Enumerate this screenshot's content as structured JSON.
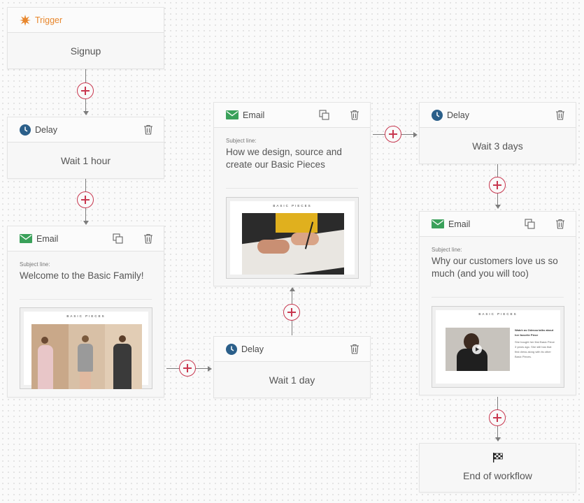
{
  "colors": {
    "accent": "#c8374f",
    "trigger": "#e8872d",
    "delay_icon": "#2b5f8a",
    "email_icon": "#3aa15a"
  },
  "trigger": {
    "label": "Trigger",
    "body": "Signup",
    "icon": "sunburst-icon"
  },
  "delay1": {
    "label": "Delay",
    "body": "Wait 1 hour",
    "icon": "clock-icon"
  },
  "email1": {
    "label": "Email",
    "subject_label": "Subject line:",
    "subject": "Welcome to the Basic Family!",
    "preview_brand": "BASIC PIECES"
  },
  "email2": {
    "label": "Email",
    "subject_label": "Subject line:",
    "subject": "How we design, source and create our Basic Pieces",
    "preview_brand": "BASIC PIECES"
  },
  "delay2": {
    "label": "Delay",
    "body": "Wait 1 day",
    "icon": "clock-icon"
  },
  "delay3": {
    "label": "Delay",
    "body": "Wait 3 days",
    "icon": "clock-icon"
  },
  "email3": {
    "label": "Email",
    "subject_label": "Subject line:",
    "subject": "Why our customers love us so much (and you will too)",
    "preview_brand": "BASIC PIECES",
    "preview_heading": "Watch as Odessa talks about her favorite Piece",
    "preview_text": "She bought her first Basic Piece 3 years ago. She still has that first dress along with its other Basic Pieces."
  },
  "end": {
    "label": "End of workflow",
    "icon": "checkered-flag-icon"
  }
}
